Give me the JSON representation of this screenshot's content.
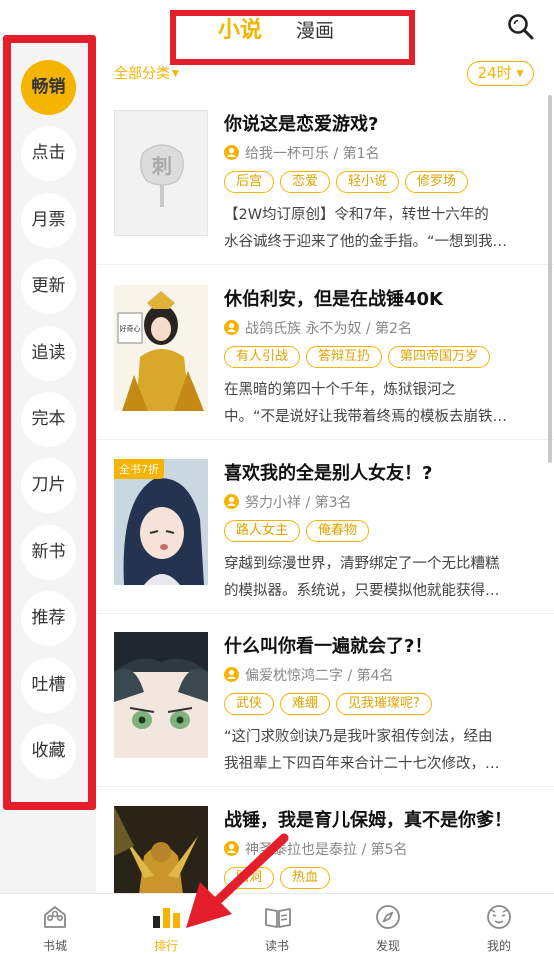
{
  "top_tabs": {
    "novel": "小说",
    "comic": "漫画"
  },
  "filter": {
    "category": "全部分类",
    "time_range": "24时"
  },
  "sidebar": {
    "items": [
      {
        "label": "畅销",
        "active": true
      },
      {
        "label": "点击"
      },
      {
        "label": "月票"
      },
      {
        "label": "更新"
      },
      {
        "label": "追读"
      },
      {
        "label": "完本"
      },
      {
        "label": "刀片"
      },
      {
        "label": "新书"
      },
      {
        "label": "推荐"
      },
      {
        "label": "吐槽"
      },
      {
        "label": "收藏"
      }
    ]
  },
  "books": [
    {
      "title": "你说这是恋爱游戏?",
      "author": "给我一杯可乐",
      "rank": "第1名",
      "tags": [
        "后宫",
        "恋爱",
        "轻小说",
        "修罗场"
      ],
      "desc_line1": "【2W均订原创】令和7年，转世十六年的",
      "desc_line2": "水谷诚终于迎来了他的金手指。“一想到我…",
      "cover_text": "刺"
    },
    {
      "title": "休伯利安，但是在战锤40K",
      "author": "战鸽氏族 永不为奴",
      "rank": "第2名",
      "tags": [
        "有人引战",
        "答辩互扔",
        "第四帝国万岁"
      ],
      "desc_line1": "在黑暗的第四十个千年，炼狱银河之",
      "desc_line2": "中。“不是说好让我带着终焉的模板去崩铁…",
      "cover_text": "好奇心"
    },
    {
      "title": "喜欢我的全是别人女友！?",
      "author": "努力小祥",
      "rank": "第3名",
      "tags": [
        "路人女主",
        "俺春物"
      ],
      "desc_line1": "穿越到综漫世界，清野绑定了一个无比糟糕",
      "desc_line2": "的模拟器。系统说，只要模拟他就能获得…",
      "badge": "全书7折"
    },
    {
      "title": "什么叫你看一遍就会了?！",
      "author": "偏爱枕惊鸿二字",
      "rank": "第4名",
      "tags": [
        "武侠",
        "难绷",
        "见我璀璨呢?"
      ],
      "desc_line1": "“这门求败剑诀乃是我叶家祖传剑法，经由",
      "desc_line2": "我祖辈上下四百年来合计二十七次修改，…"
    },
    {
      "title": "战锤，我是育儿保姆，真不是你爹！",
      "author": "神圣泰拉也是泰拉",
      "rank": "第5名",
      "tags": [
        "脑洞",
        "热血"
      ]
    }
  ],
  "bottom_nav": [
    {
      "label": "书城",
      "icon": "bookstore-icon"
    },
    {
      "label": "排行",
      "icon": "ranking-icon",
      "active": true
    },
    {
      "label": "读书",
      "icon": "open-book-icon"
    },
    {
      "label": "发现",
      "icon": "compass-icon"
    },
    {
      "label": "我的",
      "icon": "profile-face-icon"
    }
  ],
  "colors": {
    "accent": "#f4b400",
    "annotation_red": "#e41e2b",
    "sidebar_bg": "#f4f4f4"
  }
}
